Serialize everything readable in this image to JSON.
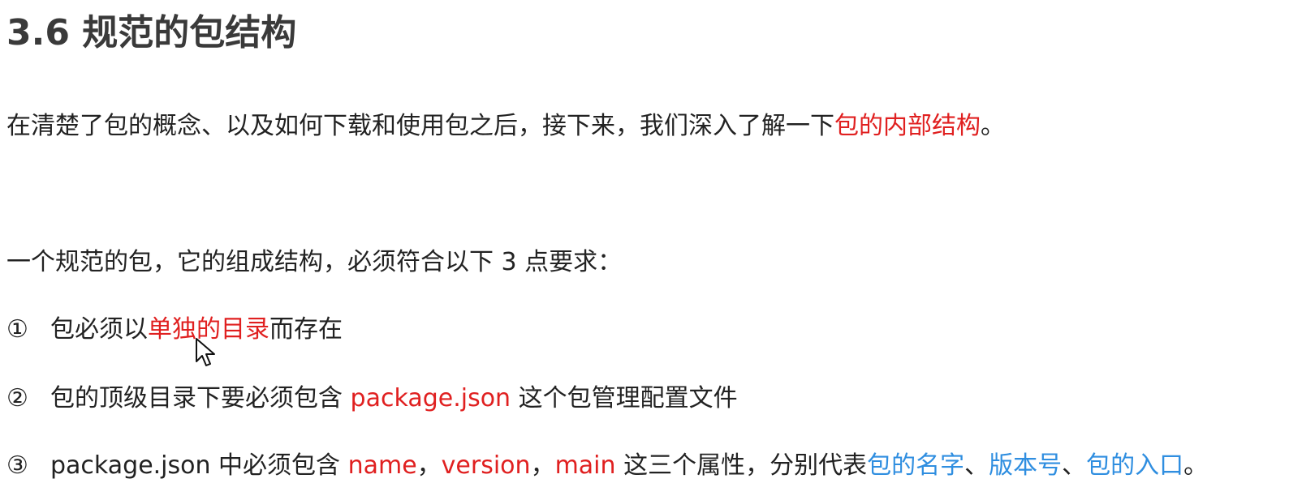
{
  "title": "3.6 规范的包结构",
  "intro": {
    "text": "在清楚了包的概念、以及如何下载和使用包之后，接下来，我们深入了解一下",
    "highlight": "包的内部结构",
    "end": "。"
  },
  "requirements_intro": "一个规范的包，它的组成结构，必须符合以下 3 点要求：",
  "items": [
    {
      "marker": "①",
      "parts": [
        "包必须以",
        "单独的目录",
        "而存在"
      ]
    },
    {
      "marker": "②",
      "parts": [
        "包的顶级目录下要必须包含 ",
        "package.json",
        " 这个包管理配置文件"
      ]
    },
    {
      "marker": "③",
      "parts": [
        "package.json 中必须包含 ",
        "name",
        "，",
        "version",
        "，",
        "main",
        " 这三个属性，分别代表",
        "包的名字",
        "、",
        "版本号",
        "、",
        "包的入口",
        "。"
      ]
    }
  ],
  "colors": {
    "highlight_red": "#e02020",
    "highlight_blue": "#2f8ee0",
    "text": "#222222",
    "heading": "#3a3a3a"
  },
  "icons": {
    "cursor": "mouse-pointer-icon"
  }
}
